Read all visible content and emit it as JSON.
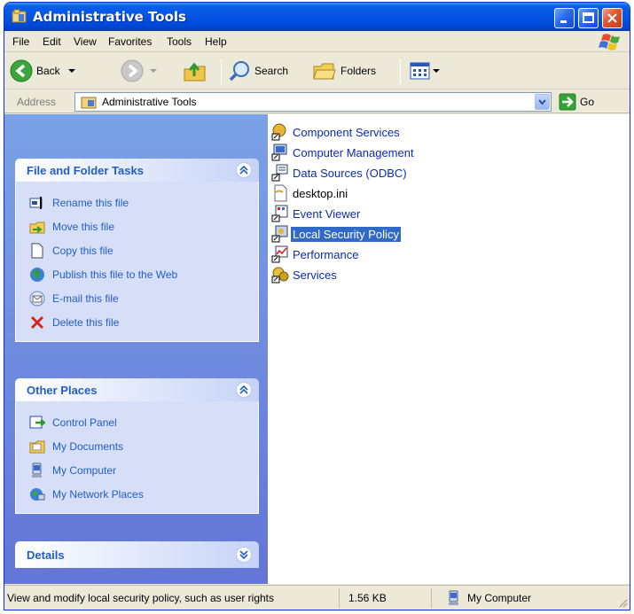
{
  "window": {
    "title": "Administrative Tools"
  },
  "menu": [
    "File",
    "Edit",
    "View",
    "Favorites",
    "Tools",
    "Help"
  ],
  "toolbar": {
    "back": "Back",
    "search": "Search",
    "folders": "Folders"
  },
  "address": {
    "label": "Address",
    "value": "Administrative Tools",
    "go": "Go"
  },
  "left_pane": {
    "file_tasks": {
      "title": "File and Folder Tasks",
      "items": [
        {
          "label": "Rename this file",
          "icon": "rename-icon"
        },
        {
          "label": "Move this file",
          "icon": "move-icon"
        },
        {
          "label": "Copy this file",
          "icon": "copy-icon"
        },
        {
          "label": "Publish this file to the Web",
          "icon": "publish-web-icon"
        },
        {
          "label": "E-mail this file",
          "icon": "email-icon"
        },
        {
          "label": "Delete this file",
          "icon": "delete-icon"
        }
      ]
    },
    "other_places": {
      "title": "Other Places",
      "items": [
        {
          "label": "Control Panel",
          "icon": "control-panel-icon"
        },
        {
          "label": "My Documents",
          "icon": "my-documents-icon"
        },
        {
          "label": "My Computer",
          "icon": "my-computer-icon"
        },
        {
          "label": "My Network Places",
          "icon": "network-places-icon"
        }
      ]
    },
    "details": {
      "title": "Details"
    }
  },
  "files": [
    {
      "name": "Component Services",
      "icon": "shortcut-icon"
    },
    {
      "name": "Computer Management",
      "icon": "shortcut-icon"
    },
    {
      "name": "Data Sources (ODBC)",
      "icon": "shortcut-icon"
    },
    {
      "name": "desktop.ini",
      "icon": "ini-file-icon"
    },
    {
      "name": "Event Viewer",
      "icon": "shortcut-icon"
    },
    {
      "name": "Local Security Policy",
      "icon": "shortcut-icon",
      "selected": true
    },
    {
      "name": "Performance",
      "icon": "shortcut-icon"
    },
    {
      "name": "Services",
      "icon": "shortcut-icon"
    }
  ],
  "status": {
    "description": "View and modify local security policy, such as user rights",
    "size": "1.56 KB",
    "zone": "My Computer"
  },
  "colors": {
    "title_bar": "#0554e3",
    "selection": "#316ac5",
    "task_link": "#215dc6",
    "task_pane": "#6f8fe0"
  }
}
